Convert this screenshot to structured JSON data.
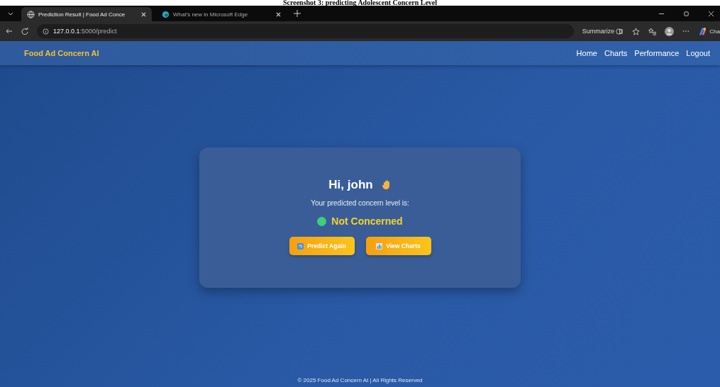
{
  "caption": "Screenshot 3: predicting Adolescent Concern Level",
  "browser": {
    "tabs": [
      {
        "title": "Prediction Result | Food Ad Conce",
        "selected": true
      },
      {
        "title": "What's new in Microsoft Edge",
        "selected": false
      }
    ],
    "address": {
      "host": "127.0.0.1",
      "path": ":5000/predict"
    },
    "summarize": "Summarize",
    "copilot": "Cha"
  },
  "navbar": {
    "brand": "Food Ad Concern AI",
    "links": [
      "Home",
      "Charts",
      "Performance",
      "Logout"
    ]
  },
  "result": {
    "greeting": "Hi, john",
    "subtitle": "Your predicted concern level is:",
    "status": {
      "label": "Not Concerned",
      "color": "#3fcf7a"
    },
    "buttons": [
      {
        "label": "Predict Again"
      },
      {
        "label": "View Charts"
      }
    ]
  },
  "footer": "© 2025 Food Ad Concern AI | All Rights Reserved"
}
